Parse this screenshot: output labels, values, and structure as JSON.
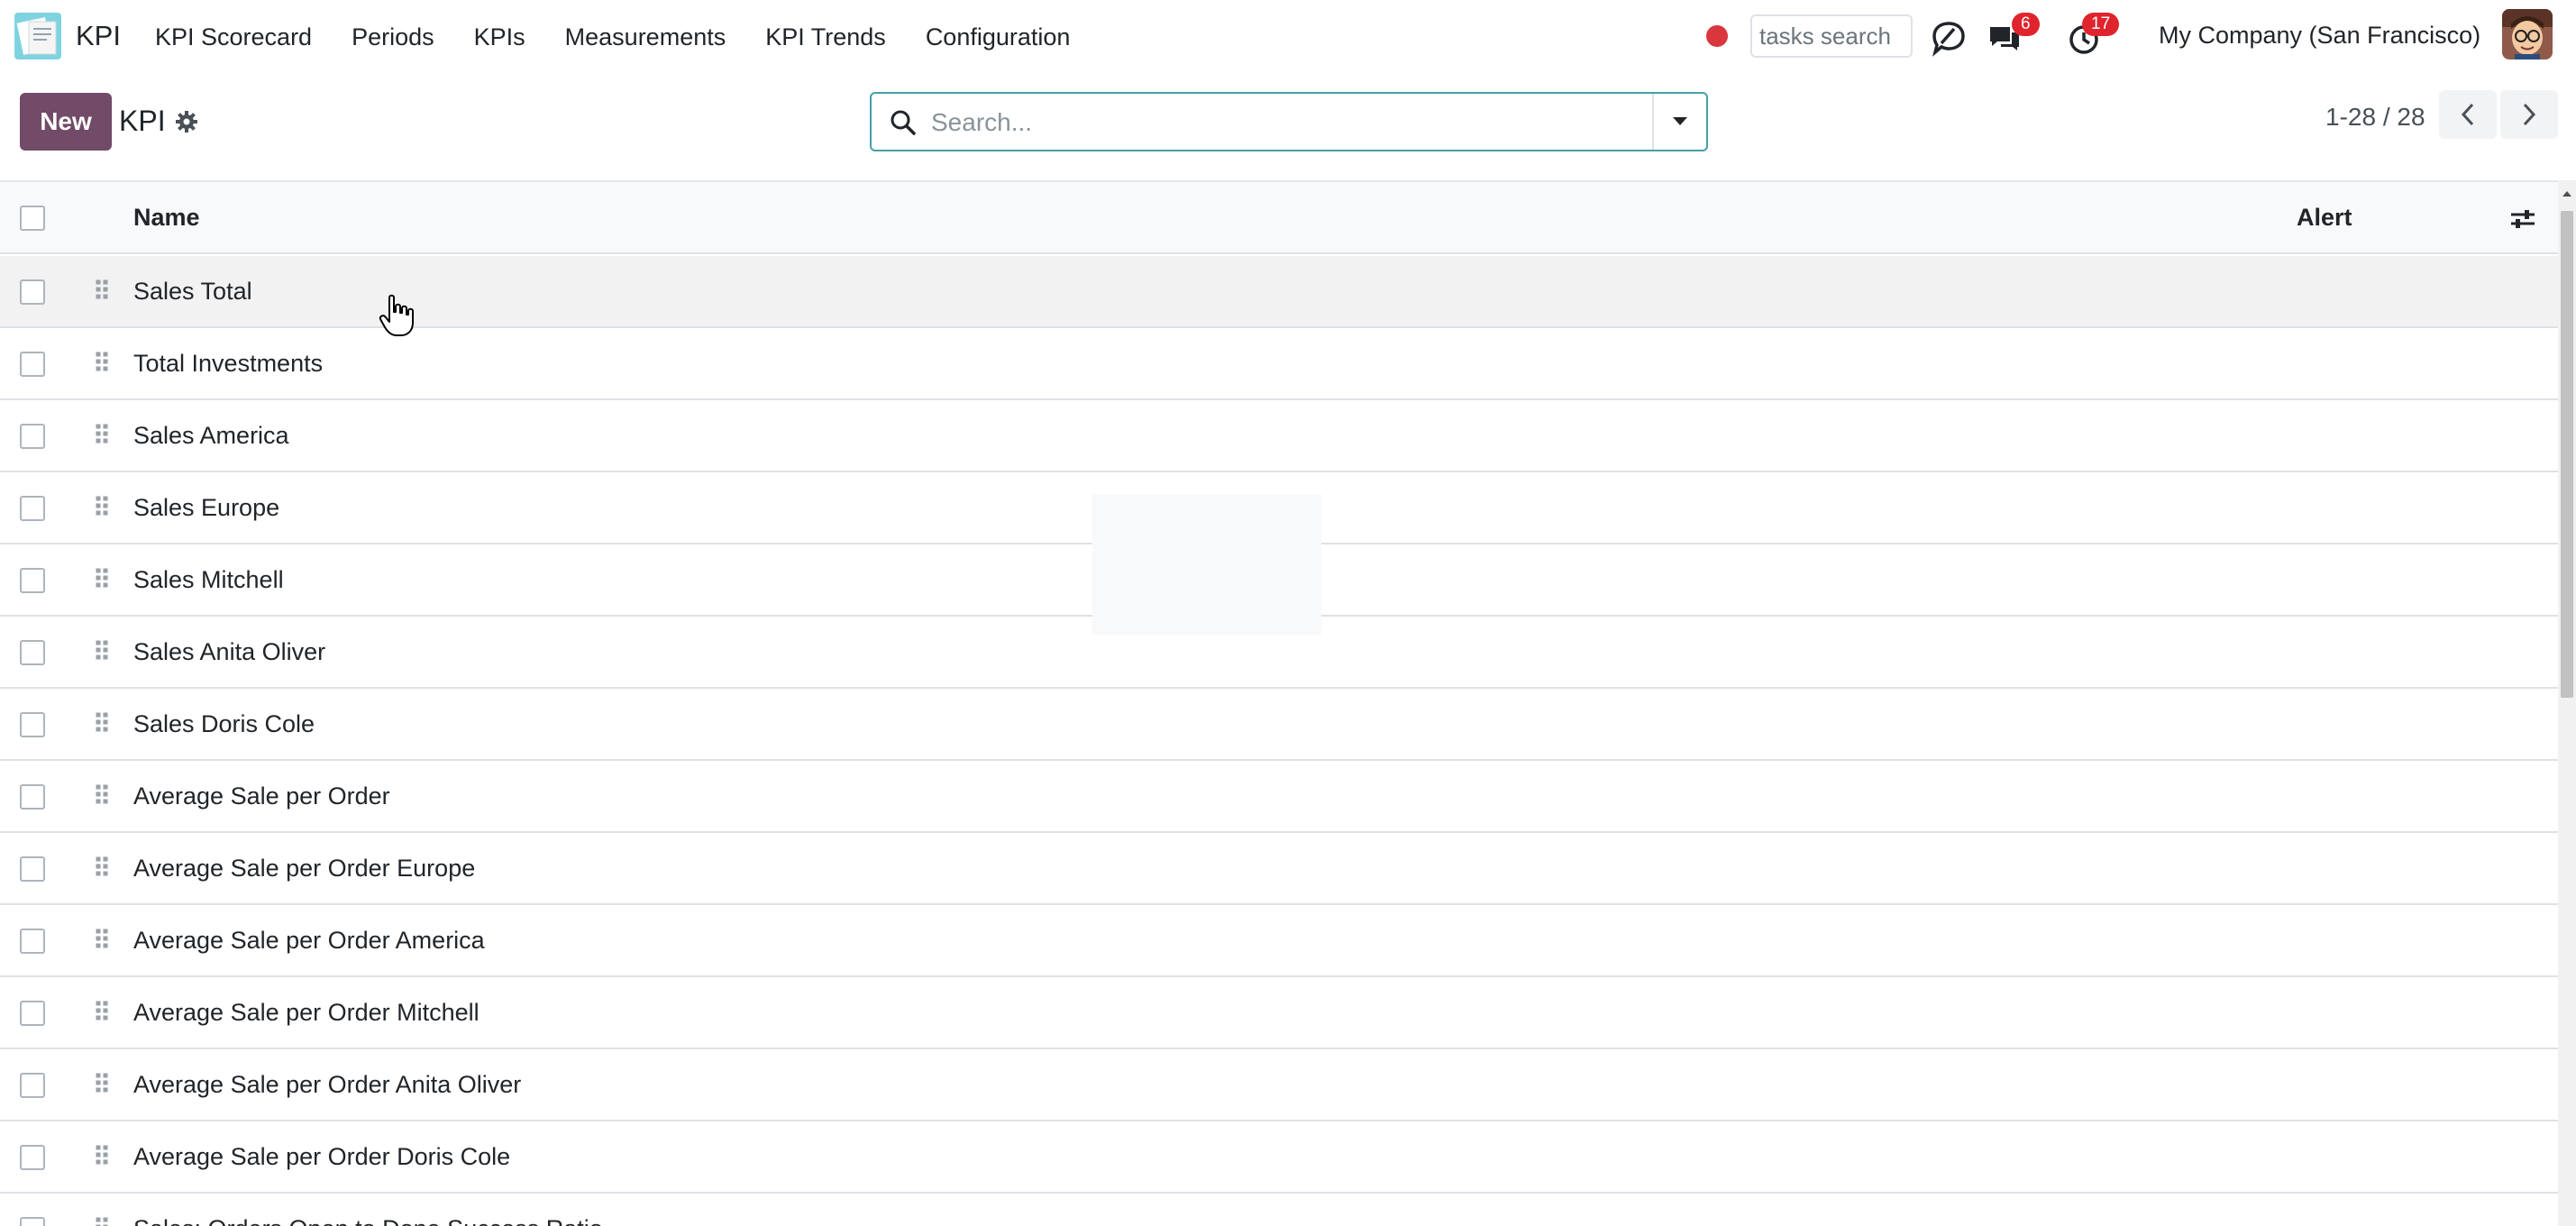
{
  "navbar": {
    "app_name": "KPI",
    "menu": [
      "KPI Scorecard",
      "Periods",
      "KPIs",
      "Measurements",
      "KPI Trends",
      "Configuration"
    ],
    "tasks_search_placeholder": "tasks search",
    "messages_count": "6",
    "activities_count": "17",
    "company": "My Company (San Francisco)",
    "icons": {
      "app_logo": "kpi-app-logo",
      "recording": "record-dot-icon",
      "discuss": "discuss-icon",
      "messages": "chat-bubbles-icon",
      "activities": "clock-icon",
      "avatar": "user-avatar"
    }
  },
  "control_panel": {
    "new_label": "New",
    "breadcrumb": "KPI",
    "search_placeholder": "Search...",
    "pager": "1-28 / 28"
  },
  "list": {
    "columns": {
      "name": "Name",
      "alert": "Alert"
    },
    "rows": [
      "Sales Total",
      "Total Investments",
      "Sales America",
      "Sales Europe",
      "Sales Mitchell",
      "Sales Anita Oliver",
      "Sales Doris Cole",
      "Average Sale per Order",
      "Average Sale per Order Europe",
      "Average Sale per Order America",
      "Average Sale per Order Mitchell",
      "Average Sale per Order Anita Oliver",
      "Average Sale per Order Doris Cole",
      "Sales: Orders Open to Done Success Ratio"
    ]
  },
  "colors": {
    "primary": "#714b67",
    "search_border": "#45a0a8",
    "badge": "#e0242d",
    "record_dot": "#d9363e"
  }
}
